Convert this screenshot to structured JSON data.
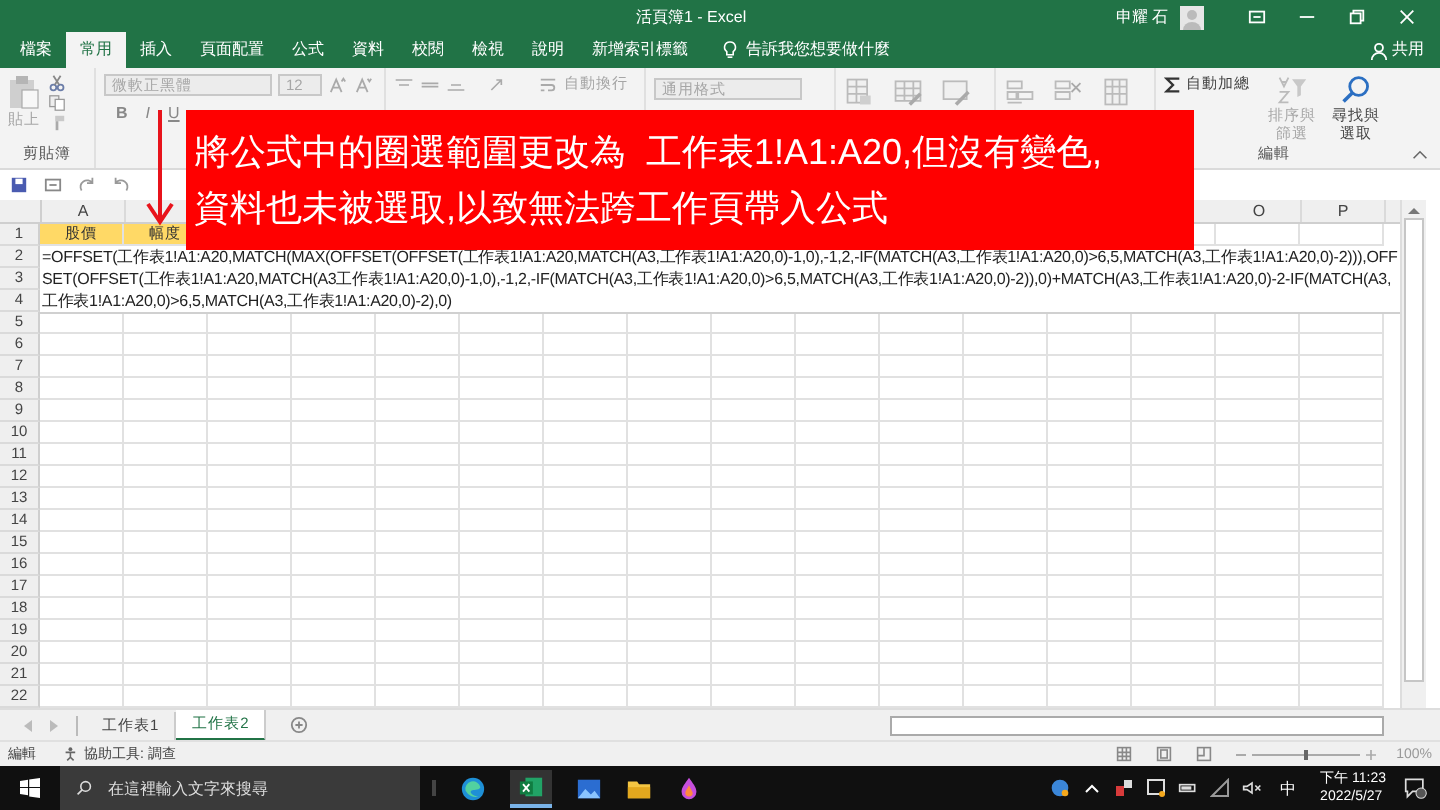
{
  "window": {
    "title": "活頁簿1 - Excel",
    "user": "申耀 石"
  },
  "ribbon_tabs": [
    {
      "label": "檔案",
      "selected": false
    },
    {
      "label": "常用",
      "selected": true
    },
    {
      "label": "插入",
      "selected": false
    },
    {
      "label": "頁面配置",
      "selected": false
    },
    {
      "label": "公式",
      "selected": false
    },
    {
      "label": "資料",
      "selected": false
    },
    {
      "label": "校閱",
      "selected": false
    },
    {
      "label": "檢視",
      "selected": false
    },
    {
      "label": "說明",
      "selected": false
    },
    {
      "label": "新增索引標籤",
      "selected": false
    }
  ],
  "tell_me": "告訴我您想要做什麼",
  "share": "共用",
  "ribbon": {
    "paste": "貼上",
    "clipboard_group": "剪貼簿",
    "font_name": "微軟正黑體",
    "font_size": "12",
    "format_buttons": [
      "B",
      "I",
      "U"
    ],
    "wrap_text": "自動換行",
    "number_format": "通用格式",
    "autosum": "自動加總",
    "sort_filter": "排序與篩選",
    "find_select": "尋找與選取",
    "editing_group": "編輯"
  },
  "callout": {
    "lines": [
      "將公式中的圈選範圍更改為  工作表1!A1:A20,但沒有變色,",
      "資料也未被選取,以致無法跨工作頁帶入公式"
    ]
  },
  "sheet": {
    "columns_left": [
      "A"
    ],
    "columns_right": [
      "O",
      "P"
    ],
    "rows": [
      "1",
      "2",
      "3",
      "4",
      "5",
      "6",
      "7",
      "8",
      "9",
      "10",
      "11",
      "12",
      "13",
      "14",
      "15",
      "16",
      "17",
      "18",
      "19",
      "20",
      "21",
      "22"
    ],
    "row1_cells": [
      "股價",
      "幅度"
    ],
    "editing_text": "=OFFSET(工作表1!A1:A20,MATCH(MAX(OFFSET(OFFSET(工作表1!A1:A20,MATCH(A3,工作表1!A1:A20,0)-1,0),-1,2,-IF(MATCH(A3,工作表1!A1:A20,0)>6,5,MATCH(A3,工作表1!A1:A20,0)-2))),OFFSET(OFFSET(工作表1!A1:A20,MATCH(A3工作表1!A1:A20,0)-1,0),-1,2,-IF(MATCH(A3,工作表1!A1:A20,0)>6,5,MATCH(A3,工作表1!A1:A20,0)-2)),0)+MATCH(A3,工作表1!A1:A20,0)-2-IF(MATCH(A3,工作表1!A1:A20,0)>6,5,MATCH(A3,工作表1!A1:A20,0)-2),0)"
  },
  "sheet_tabs": [
    {
      "label": "工作表1",
      "selected": false
    },
    {
      "label": "工作表2",
      "selected": true
    }
  ],
  "status_bar": {
    "mode": "編輯",
    "accessibility": "協助工具: 調查",
    "zoom": "100%",
    "zoom_slider": {
      "level": 0.5
    }
  },
  "taskbar": {
    "search_placeholder": "在這裡輸入文字來搜尋",
    "ime": "中",
    "time": "下午 11:23",
    "date": "2022/5/27"
  }
}
